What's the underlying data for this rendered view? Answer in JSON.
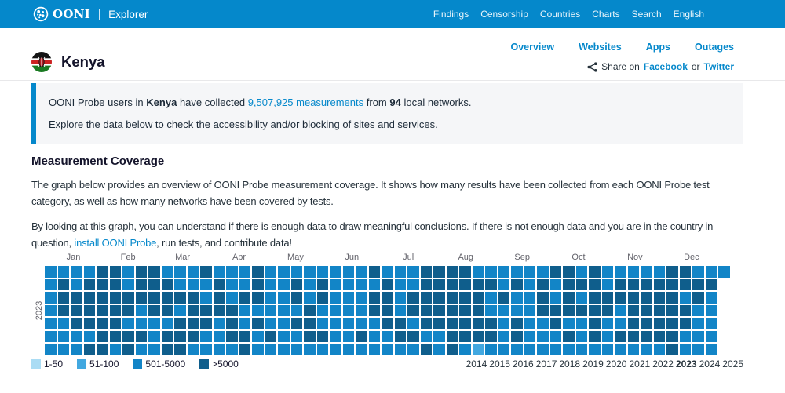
{
  "navbar": {
    "brand": "OONI",
    "brand_sub": "Explorer",
    "items": [
      "Findings",
      "Censorship",
      "Countries",
      "Charts",
      "Search",
      "English"
    ]
  },
  "header": {
    "country": "Kenya",
    "links": [
      "Overview",
      "Websites",
      "Apps",
      "Outages"
    ],
    "share": {
      "prefix": "Share on",
      "facebook": "Facebook",
      "or": "or",
      "twitter": "Twitter"
    }
  },
  "info_box": {
    "pre": "OONI Probe users in",
    "country": "Kenya",
    "mid": "have collected",
    "link": "9,507,925 measurements",
    "from": "from",
    "networks": "94",
    "post": "local networks.",
    "line2": "Explore the data below to check the accessibility and/or blocking of sites and services."
  },
  "section": {
    "title": "Measurement Coverage",
    "para1": "The graph below provides an overview of OONI Probe measurement coverage. It shows how many results have been collected from each OONI Probe test category, as well as how many networks have been covered by tests.",
    "para2_pre": "By looking at this graph, you can understand if there is enough data to draw meaningful conclusions. If there is not enough data and you are in the country in question,",
    "para2_link": "install OONI Probe",
    "para2_post": ", run tests, and contribute data!"
  },
  "chart_data": {
    "type": "heatmap",
    "title": "OONI Probe measurement coverage calendar heatmap",
    "year_label": "2023",
    "weeks": 53,
    "rows": 7,
    "palette": {
      "a": "#aadcf4",
      "b": "#42a8e0",
      "c": "#1285c7",
      "d": "#0f5e8c"
    },
    "legend": [
      {
        "key": "a",
        "label": "1-50"
      },
      {
        "key": "b",
        "label": "51-100"
      },
      {
        "key": "c",
        "label": "501-5000"
      },
      {
        "key": "d",
        "label": ">5000"
      }
    ],
    "months": [
      {
        "label": "Jan",
        "center_week": 2.21
      },
      {
        "label": "Feb",
        "center_week": 6.43
      },
      {
        "label": "Mar",
        "center_week": 10.64
      },
      {
        "label": "Apr",
        "center_week": 15.0
      },
      {
        "label": "May",
        "center_week": 19.36
      },
      {
        "label": "Jun",
        "center_week": 23.71
      },
      {
        "label": "Jul",
        "center_week": 28.07
      },
      {
        "label": "Aug",
        "center_week": 32.5
      },
      {
        "label": "Sep",
        "center_week": 36.86
      },
      {
        "label": "Oct",
        "center_week": 41.21
      },
      {
        "label": "Nov",
        "center_week": 45.57
      },
      {
        "label": "Dec",
        "center_week": 49.93
      }
    ],
    "grid_rows": [
      [
        "ccccddcddcccdc",
        "ccdccccccccdcc",
        "cddddccccccddc",
        "dcccccddccc"
      ],
      [
        "cdcdddcdddcccd",
        "ccdccdcdccccdc",
        "cddddddcdcdcdd",
        "dcdddddddd"
      ],
      [
        "cdddddddddddcd",
        "cddccdcdcccddc",
        "ddddddcdccdcdc",
        "dddddddcdc"
      ],
      [
        "cddddddcddcddd",
        "dcccccdccccddc",
        "ddddddccccdddd",
        "ddcdddddcc"
      ],
      [
        "ccddddccccdddc",
        "dcdccddcccccdd",
        "cddddddcdccdcc",
        "dccdddddcc"
      ],
      [
        "ccccddddcdddcc",
        "ddcdccddccdccd",
        "dccddddcdcccdc",
        "dcdddddccc"
      ],
      [
        "cccddcdccddccc",
        "cdcccccccccccc",
        "cdcdcbcccccccc",
        "ccccccdccc"
      ]
    ],
    "years": [
      "2014",
      "2015",
      "2016",
      "2017",
      "2018",
      "2019",
      "2020",
      "2021",
      "2022",
      "2023",
      "2024",
      "2025"
    ],
    "selected_year": "2023"
  }
}
